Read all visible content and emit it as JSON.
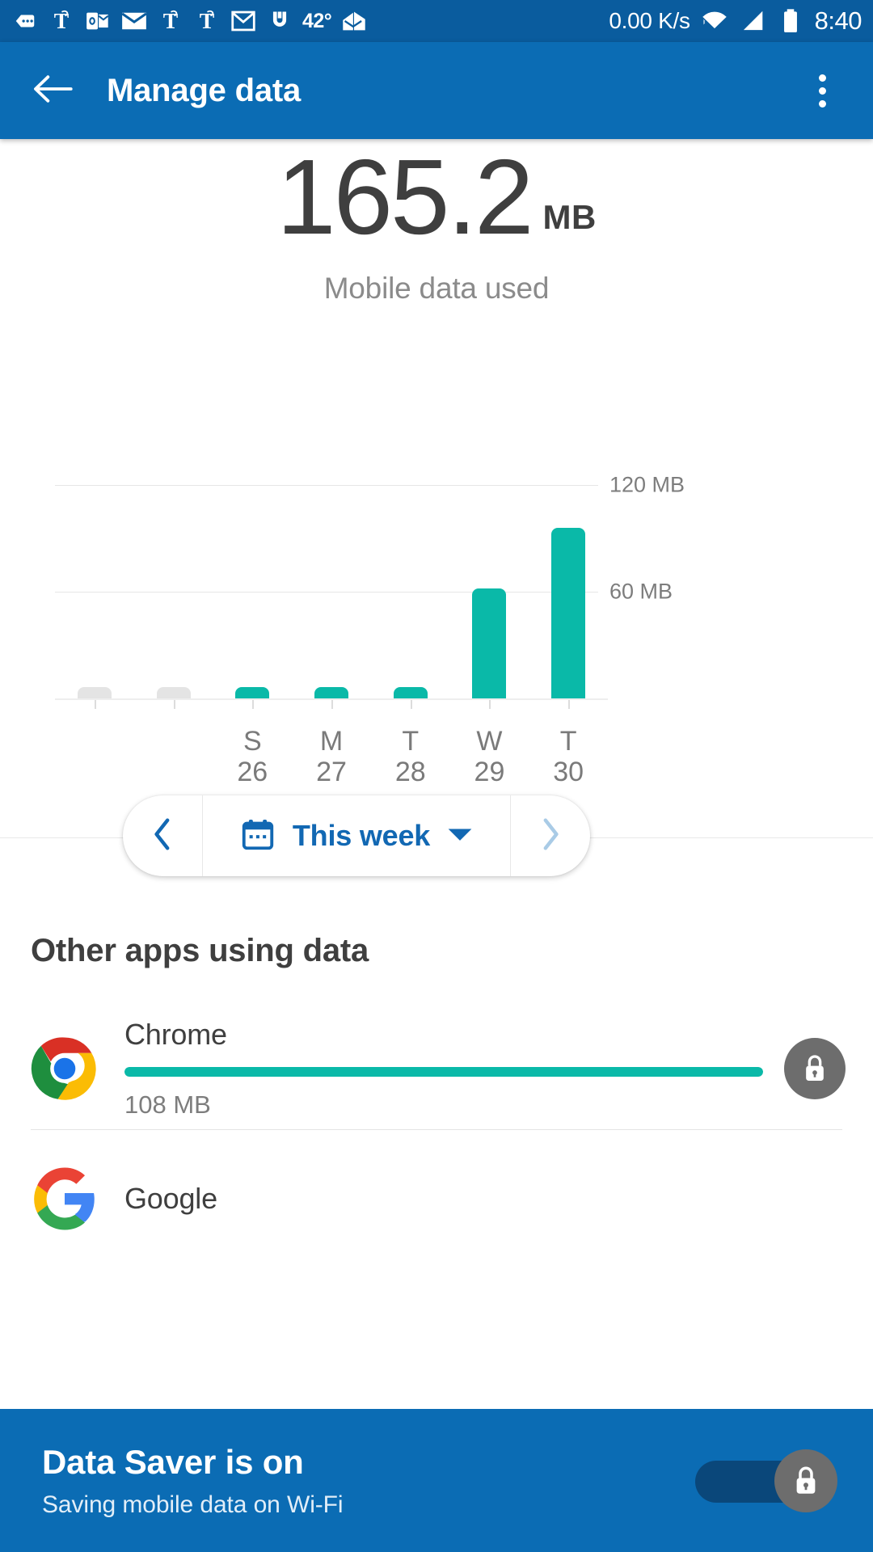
{
  "colors": {
    "status_bar": "#0a5c9e",
    "app_bar": "#0b6cb4",
    "accent_teal": "#0ab9a8",
    "accent_blue": "#1268b3",
    "bar_empty_gray": "#e4e4e4",
    "text_dark": "#3f3f3f",
    "text_muted": "#7d7d7d"
  },
  "status_bar": {
    "icons": [
      "messages-icon",
      "nytimes-icon",
      "outlook-icon",
      "mail-envelope-icon",
      "nytimes-icon",
      "nytimes-icon",
      "gmail-icon",
      "fitness-icon"
    ],
    "temperature": "42°",
    "weather_icon": "weather-home-icon",
    "network_speed": "0.00 K/s",
    "wifi_icon": "wifi-icon",
    "signal_icon": "cellular-signal-icon",
    "battery_icon": "battery-full-icon",
    "clock": "8:40"
  },
  "app_bar": {
    "back_icon": "back-arrow-icon",
    "title": "Manage data",
    "overflow_icon": "overflow-menu-icon"
  },
  "summary": {
    "value": "165.2",
    "unit": "MB",
    "caption": "Mobile data used"
  },
  "chart_data": {
    "type": "bar",
    "title": "Mobile data used",
    "categories": [
      "",
      "",
      "S 26",
      "M 27",
      "T 28",
      "W 29",
      "T 30"
    ],
    "day_labels": [
      "",
      "",
      "S",
      "M",
      "T",
      "W",
      "T"
    ],
    "date_labels": [
      "",
      "",
      "26",
      "27",
      "28",
      "29",
      "30"
    ],
    "values": [
      0,
      0,
      2.5,
      2.5,
      2.5,
      62,
      96
    ],
    "bar_colors": [
      "#e4e4e4",
      "#e4e4e4",
      "#0ab9a8",
      "#0ab9a8",
      "#0ab9a8",
      "#0ab9a8",
      "#0ab9a8"
    ],
    "ylim": [
      0,
      150
    ],
    "yticks": [
      60,
      120
    ],
    "ytick_labels": [
      "60 MB",
      "120 MB"
    ],
    "xlabel": "",
    "ylabel": "",
    "grid": true,
    "legend": "none"
  },
  "week_selector": {
    "prev_icon": "chevron-left-icon",
    "next_icon": "chevron-right-icon",
    "calendar_icon": "calendar-icon",
    "label": "This week",
    "dropdown_icon": "chevron-down-icon"
  },
  "other_apps": {
    "heading": "Other apps using data",
    "items": [
      {
        "icon": "chrome-icon",
        "name": "Chrome",
        "size": "108 MB",
        "bar_percent": 100,
        "badge_icon": "lock-icon"
      },
      {
        "icon": "google-icon",
        "name": "Google",
        "size": "",
        "bar_percent": 0,
        "badge_icon": "lock-icon"
      }
    ]
  },
  "data_saver_banner": {
    "title": "Data Saver is on",
    "subtitle": "Saving mobile data on Wi-Fi",
    "toggle_state": "on",
    "toggle_icon": "lock-icon"
  }
}
